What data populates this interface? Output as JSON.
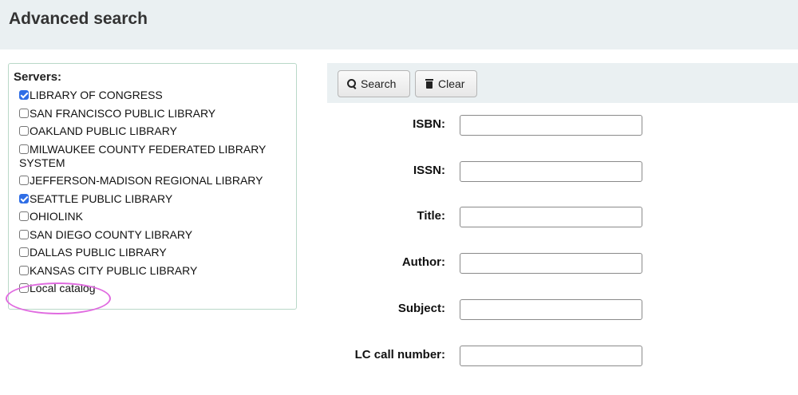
{
  "header": {
    "title": "Advanced search"
  },
  "servers": {
    "legend": "Servers:",
    "items": [
      {
        "label": "LIBRARY OF CONGRESS",
        "checked": true
      },
      {
        "label": "SAN FRANCISCO PUBLIC LIBRARY",
        "checked": false
      },
      {
        "label": "OAKLAND PUBLIC LIBRARY",
        "checked": false
      },
      {
        "label": "MILWAUKEE COUNTY FEDERATED LIBRARY SYSTEM",
        "checked": false
      },
      {
        "label": "JEFFERSON-MADISON REGIONAL LIBRARY",
        "checked": false
      },
      {
        "label": "SEATTLE PUBLIC LIBRARY",
        "checked": true
      },
      {
        "label": "OHIOLINK",
        "checked": false
      },
      {
        "label": "SAN DIEGO COUNTY LIBRARY",
        "checked": false
      },
      {
        "label": "DALLAS PUBLIC LIBRARY",
        "checked": false
      },
      {
        "label": "KANSAS CITY PUBLIC LIBRARY",
        "checked": false
      },
      {
        "label": "Local catalog",
        "checked": false
      }
    ]
  },
  "toolbar": {
    "search_label": "Search",
    "search_icon": "search-icon",
    "clear_label": "Clear",
    "clear_icon": "trash-icon"
  },
  "form": {
    "fields": [
      {
        "label": "ISBN:",
        "value": ""
      },
      {
        "label": "ISSN:",
        "value": ""
      },
      {
        "label": "Title:",
        "value": ""
      },
      {
        "label": "Author:",
        "value": ""
      },
      {
        "label": "Subject:",
        "value": ""
      },
      {
        "label": "LC call number:",
        "value": ""
      }
    ]
  },
  "colors": {
    "header_bg": "#eaf0f2",
    "checkbox_checked": "#2f6ee6",
    "annotation": "#e06be0"
  }
}
